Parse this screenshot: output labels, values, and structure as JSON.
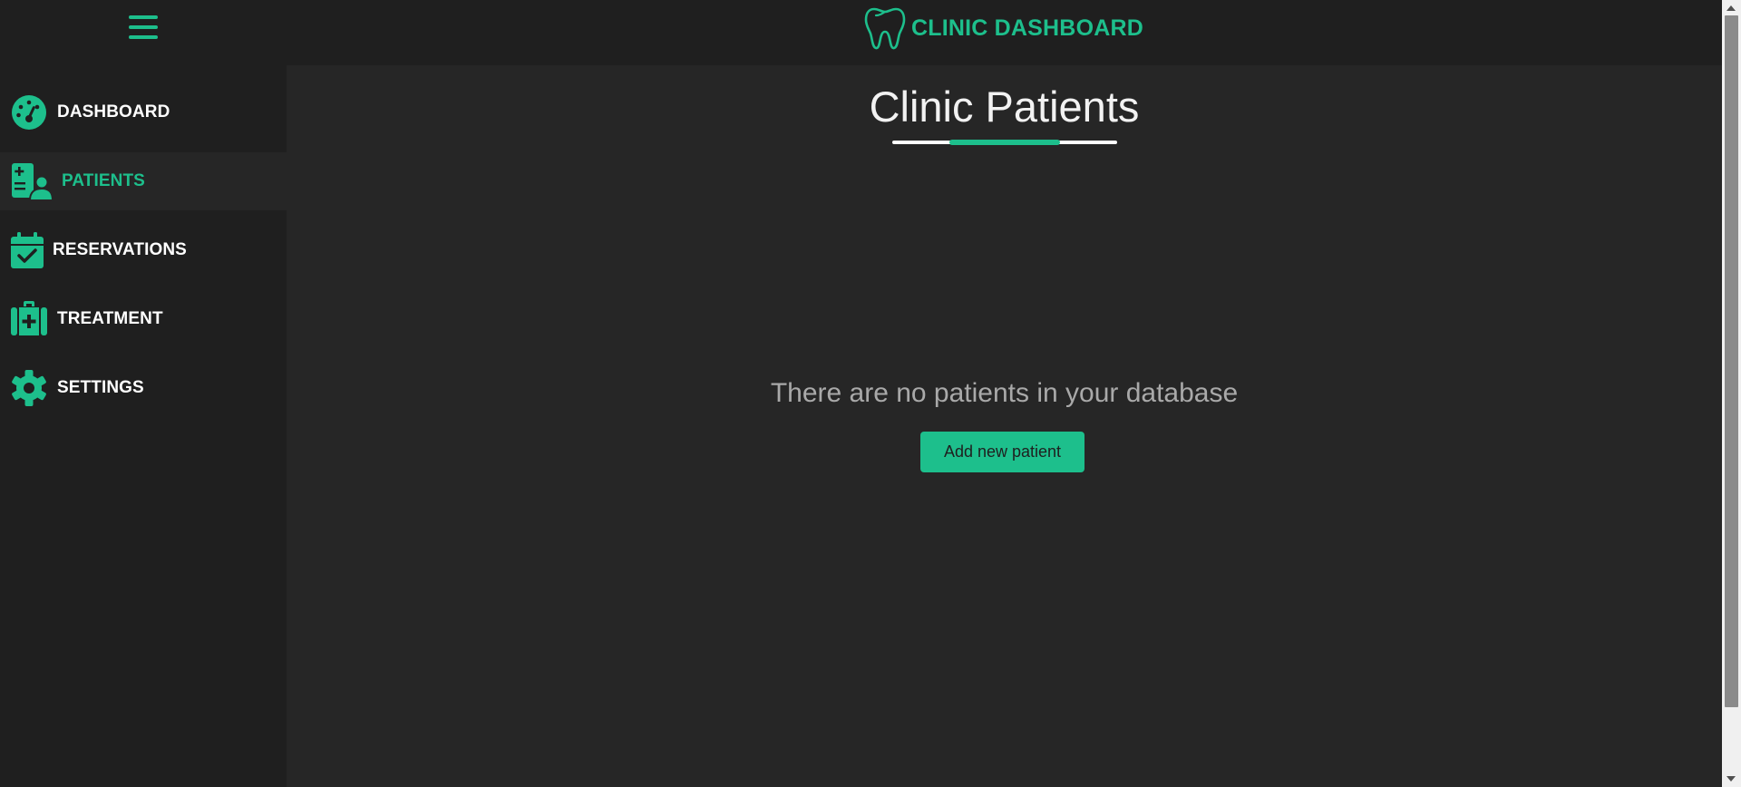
{
  "header": {
    "brand_title": "CLINIC DASHBOARD",
    "brand_icon": "tooth-icon",
    "menu_icon": "hamburger-menu-icon"
  },
  "sidebar": {
    "items": [
      {
        "label": "DASHBOARD",
        "icon": "gauge-icon",
        "active": false
      },
      {
        "label": "PATIENTS",
        "icon": "patient-record-icon",
        "active": true
      },
      {
        "label": "RESERVATIONS",
        "icon": "calendar-check-icon",
        "active": false
      },
      {
        "label": "TREATMENT",
        "icon": "medical-kit-icon",
        "active": false
      },
      {
        "label": "SETTINGS",
        "icon": "gear-icon",
        "active": false
      }
    ]
  },
  "main": {
    "title": "Clinic Patients",
    "empty_message": "There are no patients in your database",
    "add_button_label": "Add new patient"
  },
  "colors": {
    "accent": "#1dbf8c",
    "background": "#262626",
    "sidebar": "#1f1f1f",
    "text": "#ffffff",
    "muted_text": "#a9a9a9"
  }
}
